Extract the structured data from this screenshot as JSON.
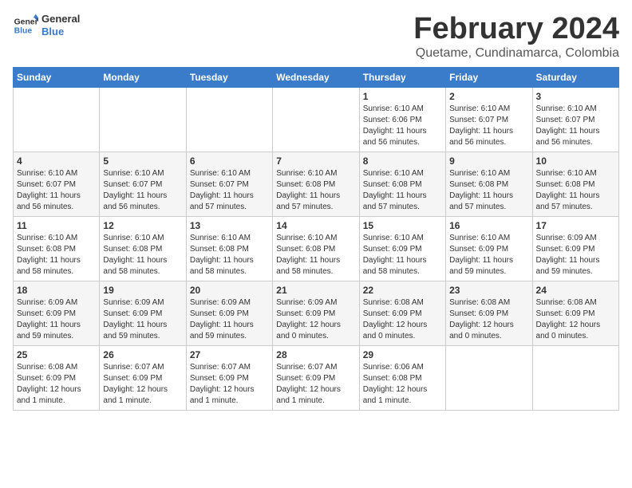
{
  "logo": {
    "line1": "General",
    "line2": "Blue"
  },
  "title": "February 2024",
  "subtitle": "Quetame, Cundinamarca, Colombia",
  "days_of_week": [
    "Sunday",
    "Monday",
    "Tuesday",
    "Wednesday",
    "Thursday",
    "Friday",
    "Saturday"
  ],
  "weeks": [
    [
      {
        "day": "",
        "info": ""
      },
      {
        "day": "",
        "info": ""
      },
      {
        "day": "",
        "info": ""
      },
      {
        "day": "",
        "info": ""
      },
      {
        "day": "1",
        "info": "Sunrise: 6:10 AM\nSunset: 6:06 PM\nDaylight: 11 hours\nand 56 minutes."
      },
      {
        "day": "2",
        "info": "Sunrise: 6:10 AM\nSunset: 6:07 PM\nDaylight: 11 hours\nand 56 minutes."
      },
      {
        "day": "3",
        "info": "Sunrise: 6:10 AM\nSunset: 6:07 PM\nDaylight: 11 hours\nand 56 minutes."
      }
    ],
    [
      {
        "day": "4",
        "info": "Sunrise: 6:10 AM\nSunset: 6:07 PM\nDaylight: 11 hours\nand 56 minutes."
      },
      {
        "day": "5",
        "info": "Sunrise: 6:10 AM\nSunset: 6:07 PM\nDaylight: 11 hours\nand 56 minutes."
      },
      {
        "day": "6",
        "info": "Sunrise: 6:10 AM\nSunset: 6:07 PM\nDaylight: 11 hours\nand 57 minutes."
      },
      {
        "day": "7",
        "info": "Sunrise: 6:10 AM\nSunset: 6:08 PM\nDaylight: 11 hours\nand 57 minutes."
      },
      {
        "day": "8",
        "info": "Sunrise: 6:10 AM\nSunset: 6:08 PM\nDaylight: 11 hours\nand 57 minutes."
      },
      {
        "day": "9",
        "info": "Sunrise: 6:10 AM\nSunset: 6:08 PM\nDaylight: 11 hours\nand 57 minutes."
      },
      {
        "day": "10",
        "info": "Sunrise: 6:10 AM\nSunset: 6:08 PM\nDaylight: 11 hours\nand 57 minutes."
      }
    ],
    [
      {
        "day": "11",
        "info": "Sunrise: 6:10 AM\nSunset: 6:08 PM\nDaylight: 11 hours\nand 58 minutes."
      },
      {
        "day": "12",
        "info": "Sunrise: 6:10 AM\nSunset: 6:08 PM\nDaylight: 11 hours\nand 58 minutes."
      },
      {
        "day": "13",
        "info": "Sunrise: 6:10 AM\nSunset: 6:08 PM\nDaylight: 11 hours\nand 58 minutes."
      },
      {
        "day": "14",
        "info": "Sunrise: 6:10 AM\nSunset: 6:08 PM\nDaylight: 11 hours\nand 58 minutes."
      },
      {
        "day": "15",
        "info": "Sunrise: 6:10 AM\nSunset: 6:09 PM\nDaylight: 11 hours\nand 58 minutes."
      },
      {
        "day": "16",
        "info": "Sunrise: 6:10 AM\nSunset: 6:09 PM\nDaylight: 11 hours\nand 59 minutes."
      },
      {
        "day": "17",
        "info": "Sunrise: 6:09 AM\nSunset: 6:09 PM\nDaylight: 11 hours\nand 59 minutes."
      }
    ],
    [
      {
        "day": "18",
        "info": "Sunrise: 6:09 AM\nSunset: 6:09 PM\nDaylight: 11 hours\nand 59 minutes."
      },
      {
        "day": "19",
        "info": "Sunrise: 6:09 AM\nSunset: 6:09 PM\nDaylight: 11 hours\nand 59 minutes."
      },
      {
        "day": "20",
        "info": "Sunrise: 6:09 AM\nSunset: 6:09 PM\nDaylight: 11 hours\nand 59 minutes."
      },
      {
        "day": "21",
        "info": "Sunrise: 6:09 AM\nSunset: 6:09 PM\nDaylight: 12 hours\nand 0 minutes."
      },
      {
        "day": "22",
        "info": "Sunrise: 6:08 AM\nSunset: 6:09 PM\nDaylight: 12 hours\nand 0 minutes."
      },
      {
        "day": "23",
        "info": "Sunrise: 6:08 AM\nSunset: 6:09 PM\nDaylight: 12 hours\nand 0 minutes."
      },
      {
        "day": "24",
        "info": "Sunrise: 6:08 AM\nSunset: 6:09 PM\nDaylight: 12 hours\nand 0 minutes."
      }
    ],
    [
      {
        "day": "25",
        "info": "Sunrise: 6:08 AM\nSunset: 6:09 PM\nDaylight: 12 hours\nand 1 minute."
      },
      {
        "day": "26",
        "info": "Sunrise: 6:07 AM\nSunset: 6:09 PM\nDaylight: 12 hours\nand 1 minute."
      },
      {
        "day": "27",
        "info": "Sunrise: 6:07 AM\nSunset: 6:09 PM\nDaylight: 12 hours\nand 1 minute."
      },
      {
        "day": "28",
        "info": "Sunrise: 6:07 AM\nSunset: 6:09 PM\nDaylight: 12 hours\nand 1 minute."
      },
      {
        "day": "29",
        "info": "Sunrise: 6:06 AM\nSunset: 6:08 PM\nDaylight: 12 hours\nand 1 minute."
      },
      {
        "day": "",
        "info": ""
      },
      {
        "day": "",
        "info": ""
      }
    ]
  ]
}
